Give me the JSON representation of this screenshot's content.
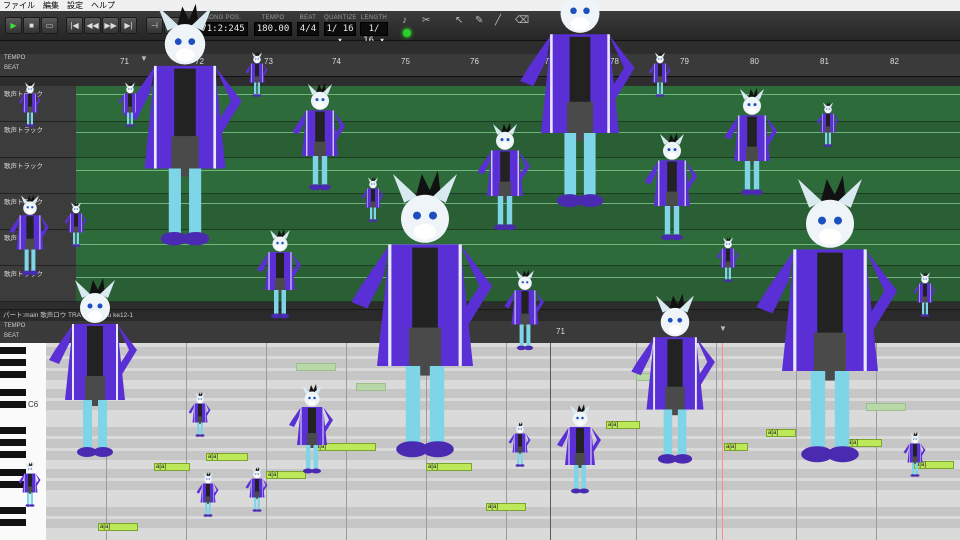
{
  "menu": [
    "ファイル",
    "編集",
    "設定",
    "ヘルプ"
  ],
  "toolbar": {
    "song_pos_label": "SONG POS.",
    "song_pos": "71:2:245",
    "tempo_label": "TEMPO",
    "tempo": "180.00",
    "beat_label": "BEAT",
    "beat": "4/4",
    "quantize_label": "QUANTIZE",
    "quantize": "1/ 16 ▾",
    "length_label": "LENGTH",
    "length": "1/ 16 ▾"
  },
  "upper": {
    "tempo_label": "TEMPO",
    "beat_label": "BEAT",
    "bars": [
      "71",
      "72",
      "73",
      "74",
      "75",
      "76",
      "77",
      "78",
      "79",
      "80",
      "81",
      "82"
    ],
    "tracks": [
      "歌声トラック",
      "歌声トラック",
      "歌声トラック",
      "歌声トラック",
      "歌声トラック",
      "歌声トラック"
    ]
  },
  "lower": {
    "header": "パート:main  歌声ロウ TRA  R3:D-Stru  ke12-1",
    "tempo_label": "TEMPO",
    "beat_label": "BEAT",
    "bar_71": "71",
    "c6": "C6",
    "note_lyric": "a[a]"
  },
  "colors": {
    "lane": "#2e6b3b",
    "note": "#bde85a",
    "play": "#3fdc3f",
    "coat": "#5a2fd6"
  }
}
